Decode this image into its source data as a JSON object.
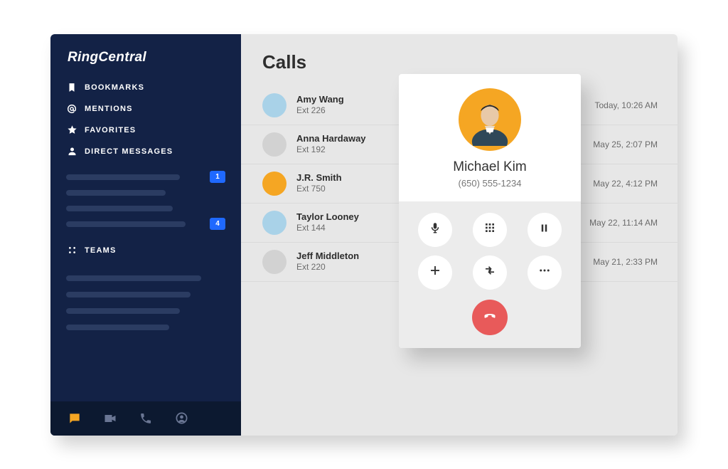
{
  "brand": "RingCentral",
  "sidebar": {
    "nav": [
      {
        "label": "BOOKMARKS",
        "icon": "bookmark-icon"
      },
      {
        "label": "MENTIONS",
        "icon": "at-icon"
      },
      {
        "label": "FAVORITES",
        "icon": "star-icon"
      },
      {
        "label": "DIRECT MESSAGES",
        "icon": "person-icon"
      }
    ],
    "direct_messages": [
      {
        "badge": "1"
      },
      {
        "badge": ""
      },
      {
        "badge": ""
      },
      {
        "badge": "4"
      }
    ],
    "teams_label": "TEAMS"
  },
  "main": {
    "title": "Calls",
    "calls": [
      {
        "name": "Amy Wang",
        "ext": "Ext 226",
        "time": "Today, 10:26 AM",
        "avatar_color": "blue"
      },
      {
        "name": "Anna Hardaway",
        "ext": "Ext 192",
        "time": "May 25, 2:07 PM",
        "avatar_color": "gray"
      },
      {
        "name": "J.R. Smith",
        "ext": "Ext 750",
        "time": "May 22, 4:12 PM",
        "avatar_color": "orange"
      },
      {
        "name": "Taylor Looney",
        "ext": "Ext 144",
        "time": "May 22,  11:14 AM",
        "avatar_color": "blue"
      },
      {
        "name": "Jeff Middleton",
        "ext": "Ext 220",
        "time": "May 21,  2:33 PM",
        "avatar_color": "gray"
      }
    ]
  },
  "call_card": {
    "name": "Michael Kim",
    "phone": "(650) 555-1234",
    "buttons": [
      "mute-icon",
      "dialpad-icon",
      "hold-icon",
      "add-icon",
      "transfer-icon",
      "more-icon"
    ],
    "hangup": "hangup-icon"
  }
}
